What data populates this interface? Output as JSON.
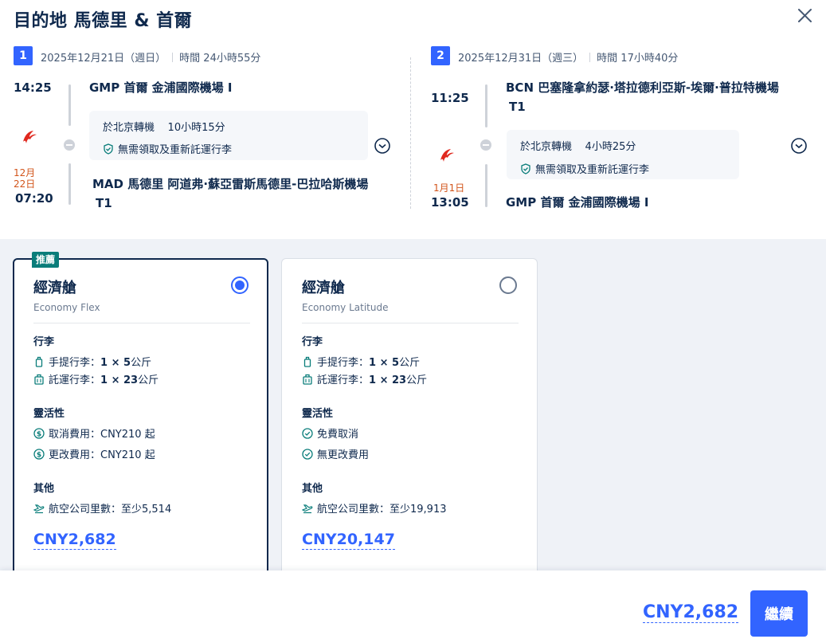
{
  "header": {
    "title": "目的地 馬德里 & 首爾"
  },
  "segments": [
    {
      "index": "1",
      "date": "2025年12月21日（週日）",
      "duration": "時間 24小時55分",
      "depart_time": "14:25",
      "depart_airport_line1": "GMP 首爾 金浦國際機場 I",
      "depart_airport_line2": "",
      "transfer_city": "於北京轉機",
      "transfer_time": "10小時15分",
      "baggage_note": "無需領取及重新託運行李",
      "arrive_date": "12月22日",
      "arrive_time": "07:20",
      "arrive_airport_line1": "MAD 馬德里 阿道弗·蘇亞雷斯馬德里-巴拉哈斯機場",
      "arrive_airport_line2": "T1"
    },
    {
      "index": "2",
      "date": "2025年12月31日（週三）",
      "duration": "時間 17小時40分",
      "depart_time": "11:25",
      "depart_airport_line1": "BCN 巴塞隆拿約瑟·塔拉德利亞斯-埃爾·普拉特機場",
      "depart_airport_line2": "T1",
      "transfer_city": "於北京轉機",
      "transfer_time": "4小時25分",
      "baggage_note": "無需領取及重新託運行李",
      "arrive_date": "1月1日",
      "arrive_time": "13:05",
      "arrive_airport_line1": "GMP 首爾 金浦國際機場 I",
      "arrive_airport_line2": ""
    }
  ],
  "fares": [
    {
      "recommended_label": "推薦",
      "name": "經濟艙",
      "subname": "Economy Flex",
      "selected": true,
      "baggage_title": "行李",
      "carry_on_label": "手提行李：",
      "carry_on_value": "1 × 5",
      "carry_on_unit": "公斤",
      "checked_label": "託運行李：",
      "checked_value": "1 × 23",
      "checked_unit": "公斤",
      "flex_title": "靈活性",
      "cancel": "取消費用：CNY210 起",
      "change": "更改費用：CNY210 起",
      "other_title": "其他",
      "miles": "航空公司里數：至少5,514",
      "price": "CNY2,682"
    },
    {
      "recommended_label": "",
      "name": "經濟艙",
      "subname": "Economy Latitude",
      "selected": false,
      "baggage_title": "行李",
      "carry_on_label": "手提行李：",
      "carry_on_value": "1 × 5",
      "carry_on_unit": "公斤",
      "checked_label": "託運行李：",
      "checked_value": "1 × 23",
      "checked_unit": "公斤",
      "flex_title": "靈活性",
      "cancel": "免費取消",
      "change": "無更改費用",
      "other_title": "其他",
      "miles": "航空公司里數：至少19,913",
      "price": "CNY20,147"
    }
  ],
  "footer": {
    "total_price": "CNY2,682",
    "continue_label": "繼續"
  },
  "colors": {
    "accent": "#3264ff",
    "recommended": "#0a7d7a",
    "airline_logo": "#e0281e",
    "next_day": "#d2541a"
  }
}
